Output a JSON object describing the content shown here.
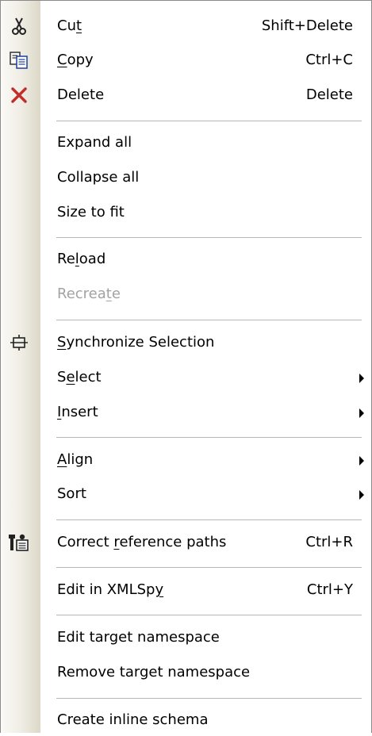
{
  "menu": {
    "cut": {
      "pre": "Cu",
      "u": "t",
      "post": "",
      "shortcut": "Shift+Delete",
      "icon": "scissors-icon"
    },
    "copy": {
      "pre": "",
      "u": "C",
      "post": "opy",
      "shortcut": "Ctrl+C",
      "icon": "copy-icon"
    },
    "delete": {
      "label": "Delete",
      "shortcut": "Delete",
      "icon": "delete-x-icon",
      "icon_color": "#c0302a"
    },
    "expand_all": {
      "label": "Expand all"
    },
    "collapse_all": {
      "label": "Collapse all"
    },
    "size_to_fit": {
      "label": "Size to fit"
    },
    "reload": {
      "pre": "Re",
      "u": "l",
      "post": "oad"
    },
    "recreate": {
      "pre": "Recrea",
      "u": "t",
      "post": "e",
      "disabled": true
    },
    "sync_selection": {
      "pre": "",
      "u": "S",
      "post": "ynchronize Selection",
      "icon": "synchronize-icon"
    },
    "select": {
      "pre": "S",
      "u": "e",
      "post": "lect",
      "submenu": true
    },
    "insert": {
      "pre": "",
      "u": "I",
      "post": "nsert",
      "submenu": true
    },
    "align": {
      "pre": "",
      "u": "A",
      "post": "lign",
      "submenu": true
    },
    "sort": {
      "label": "Sort",
      "submenu": true
    },
    "correct_paths": {
      "pre": "Correct ",
      "u": "r",
      "post": "eference paths",
      "shortcut": "Ctrl+R",
      "icon": "correct-paths-icon"
    },
    "edit_xmlspy": {
      "pre": "Edit in XMLSp",
      "u": "y",
      "post": "",
      "shortcut": "Ctrl+Y"
    },
    "edit_target_ns": {
      "label": "Edit target namespace"
    },
    "remove_target_ns": {
      "label": "Remove target namespace"
    },
    "create_inline_schema": {
      "label": "Create inline schema"
    }
  },
  "colors": {
    "disabled_text": "#a3a3a3",
    "gutter": "#eeece2",
    "separator": "#b8b8b0"
  }
}
